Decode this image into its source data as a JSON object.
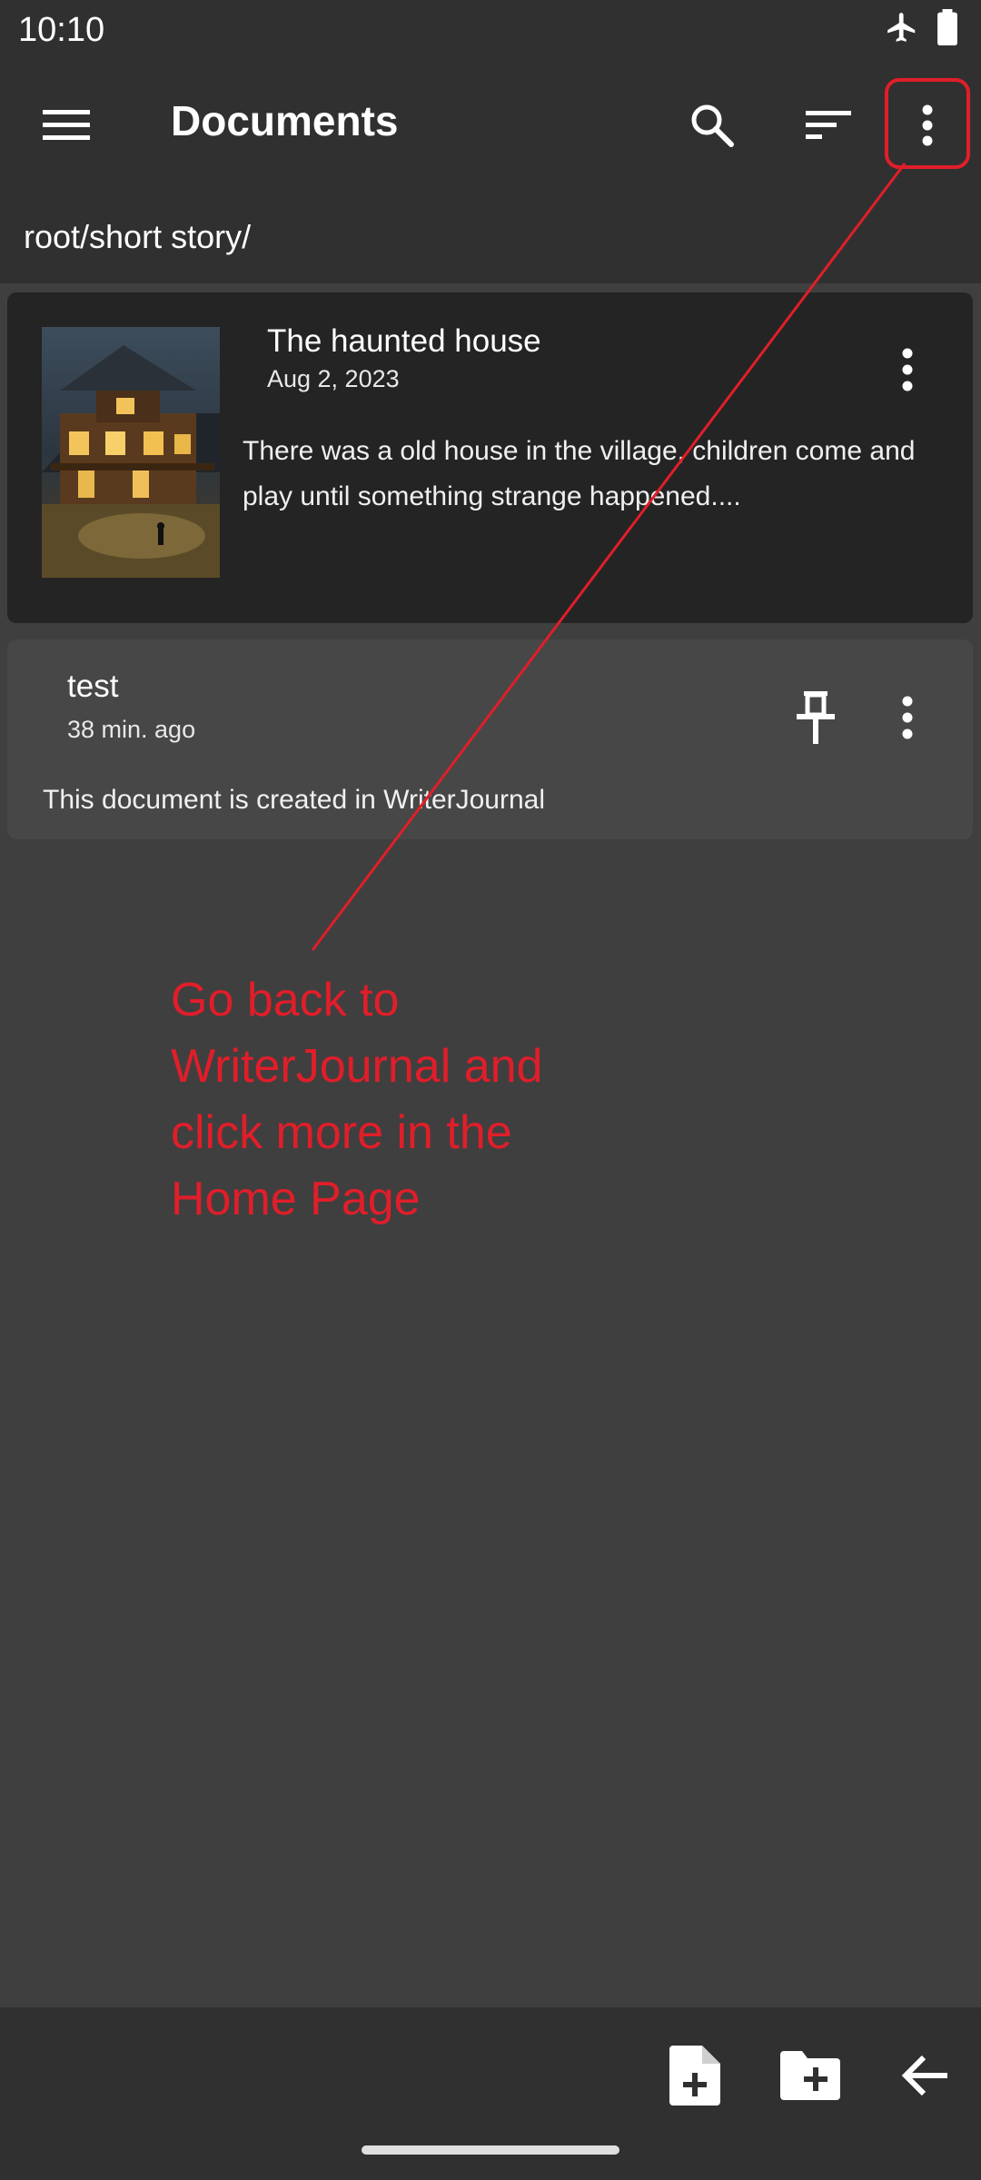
{
  "status_bar": {
    "time": "10:10",
    "icons": [
      "airplane-icon",
      "battery-icon"
    ]
  },
  "app_bar": {
    "title": "Documents",
    "actions": [
      "search-icon",
      "sort-icon",
      "more-vert-icon"
    ]
  },
  "breadcrumb": "root/short story/",
  "documents": [
    {
      "title": "The haunted house",
      "date": "Aug 2, 2023",
      "excerpt": "There was a old house in the village, children come and play until something strange happened....",
      "has_thumbnail": true,
      "pinned": false
    },
    {
      "title": "test",
      "date": "38 min. ago",
      "excerpt": "This document is created in WriterJournal",
      "has_thumbnail": false,
      "pinned": true
    }
  ],
  "bottom_bar": {
    "actions": [
      "new-document-icon",
      "new-folder-icon",
      "back-arrow-icon"
    ]
  },
  "annotation": {
    "color": "#e01e2a",
    "text": "Go back to WriterJournal and click more in the Home Page"
  },
  "colors": {
    "background": "#3f3f3f",
    "bars": "#303030",
    "card_highlight": "#242424",
    "card": "#474747"
  }
}
